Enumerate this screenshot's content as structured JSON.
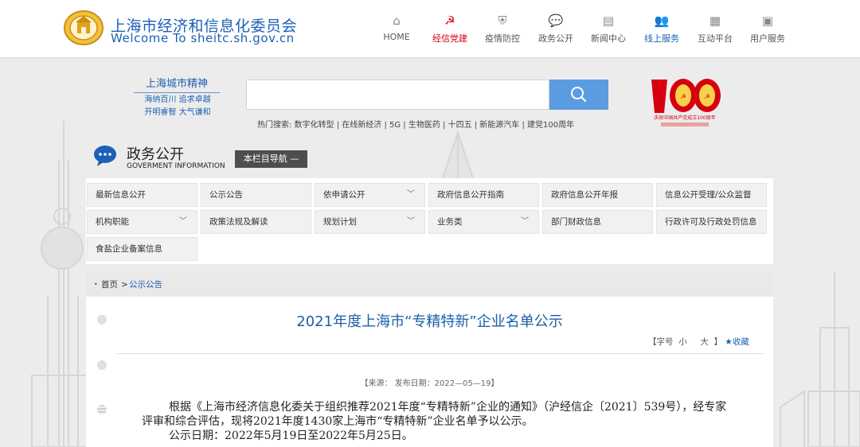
{
  "header": {
    "title": "上海市经济和信息化委员会",
    "subtitle": "Welcome To sheitc.sh.gov.cn",
    "nav": [
      {
        "label": "HOME",
        "icon": "home-icon",
        "glyph": "⌂",
        "state": "normal"
      },
      {
        "label": "经信党建",
        "icon": "hammer-sickle-icon",
        "glyph": "☭",
        "state": "active-red"
      },
      {
        "label": "疫情防控",
        "icon": "shield-icon",
        "glyph": "⛨",
        "state": "normal"
      },
      {
        "label": "政务公开",
        "icon": "chat-bubble-icon",
        "glyph": "💬",
        "state": "normal"
      },
      {
        "label": "新闻中心",
        "icon": "newspaper-icon",
        "glyph": "▤",
        "state": "normal"
      },
      {
        "label": "线上服务",
        "icon": "users-icon",
        "glyph": "👥",
        "state": "active-blue"
      },
      {
        "label": "互动平台",
        "icon": "grid-icon",
        "glyph": "▦",
        "state": "normal"
      },
      {
        "label": "用户服务",
        "icon": "briefcase-icon",
        "glyph": "▣",
        "state": "normal"
      }
    ]
  },
  "banner": {
    "slogan_main": "上海城市精神",
    "slogan_line1": "海纳百川 追求卓越",
    "slogan_line2": "开明睿智 大气谦和",
    "search_placeholder": "",
    "hot_search": "热门搜索: 数字化转型 | 在线新经济 | 5G | 生物医药 | 十四五 | 新能源汽车 | 建党100周年",
    "badge_number": "100",
    "badge_caption": "庆祝中国共产党成立100周年"
  },
  "section": {
    "title": "政务公开",
    "subtitle": "GOVERMENT INFORMATION",
    "nav_button": "本栏目导航 —"
  },
  "categories": [
    {
      "label": "最新信息公开",
      "dropdown": false
    },
    {
      "label": "公示公告",
      "dropdown": false
    },
    {
      "label": "依申请公开",
      "dropdown": true
    },
    {
      "label": "政府信息公开指南",
      "dropdown": false
    },
    {
      "label": "政府信息公开年报",
      "dropdown": false
    },
    {
      "label": "信息公开受理/公众监督",
      "dropdown": false
    },
    {
      "label": "机构职能",
      "dropdown": true
    },
    {
      "label": "政策法规及解读",
      "dropdown": false
    },
    {
      "label": "规划计划",
      "dropdown": true
    },
    {
      "label": "业务类",
      "dropdown": true
    },
    {
      "label": "部门财政信息",
      "dropdown": false
    },
    {
      "label": "行政许可及行政处罚信息",
      "dropdown": false
    },
    {
      "label": "食盐企业备案信息",
      "dropdown": false
    }
  ],
  "breadcrumb": {
    "dot": "•",
    "home": "首页",
    "separator": ">",
    "current": "公示公告"
  },
  "article": {
    "title": "2021年度上海市“专精特新”企业名单公示",
    "tools": {
      "open": "【字号",
      "small": "小",
      "large": "大",
      "close": "】",
      "favorite": "★收藏"
    },
    "meta": "【来源：  发布日期：2022—05—19】",
    "para1": "根据《上海市经济信息化委关于组织推荐2021年度“专精特新”企业的通知》（沪经信企〔2021〕539号），经专家评审和综合评估，现将2021年度1430家上海市“专精特新”企业名单予以公示。",
    "para2": "公示日期：2022年5月19日至2022年5月25日。"
  },
  "colors": {
    "brand_blue": "#1d60b5",
    "party_red": "#d7000f",
    "search_button": "#5b9ce0",
    "nav_button_bg": "#4e4e4e"
  }
}
